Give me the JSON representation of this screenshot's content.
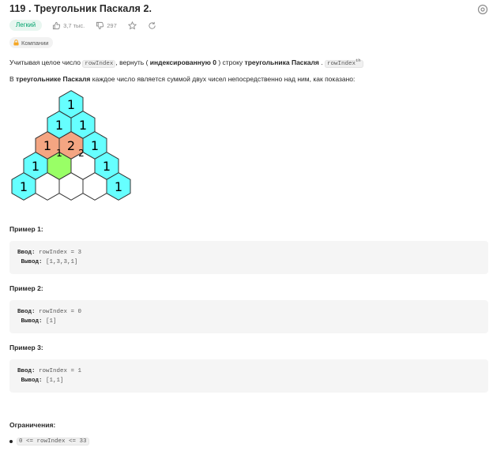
{
  "problem": {
    "title": "119 . Треугольник Паскаля 2.",
    "difficulty": "Легкий",
    "likes": "3,7 тыс.",
    "dislikes": "297",
    "companies_label": "Компании"
  },
  "description": {
    "p1_a": "Учитывая целое число ",
    "p1_code1": "rowIndex",
    "p1_b": ", вернуть ( ",
    "p1_bold1": "индексированную 0",
    "p1_c": " ) строку ",
    "p1_bold2": "треугольника Паскаля",
    "p1_d": " . ",
    "p1_code2": "rowIndex",
    "p1_sup": "th",
    "p2_a": "В ",
    "p2_bold": "треугольнике Паскаля",
    "p2_b": " каждое число является суммой двух чисел непосредственно над ним, как показано:"
  },
  "triangle": {
    "rows": [
      [
        "1"
      ],
      [
        "1",
        "1"
      ],
      [
        "1",
        "2",
        "1"
      ],
      [
        "1",
        "",
        "",
        "1"
      ],
      [
        "1",
        "",
        "",
        "",
        "1"
      ]
    ],
    "overlap_labels": [
      "1",
      "2"
    ],
    "colors": {
      "cyan": "#66ffff",
      "orange": "#f4a582",
      "green": "#99ff66",
      "empty": "#ffffff",
      "stroke": "#333333"
    }
  },
  "examples": [
    {
      "title": "Пример 1:",
      "input_label": "Ввод:",
      "input": "rowIndex = 3",
      "output_label": "Вывод:",
      "output": "[1,3,3,1]"
    },
    {
      "title": "Пример 2:",
      "input_label": "Ввод:",
      "input": "rowIndex = 0",
      "output_label": "Вывод:",
      "output": "[1]"
    },
    {
      "title": "Пример 3:",
      "input_label": "Ввод:",
      "input": "rowIndex = 1",
      "output_label": "Вывод:",
      "output": "[1,1]"
    }
  ],
  "constraints": {
    "title": "Ограничения:",
    "items": [
      "0 <= rowIndex <= 33"
    ]
  }
}
